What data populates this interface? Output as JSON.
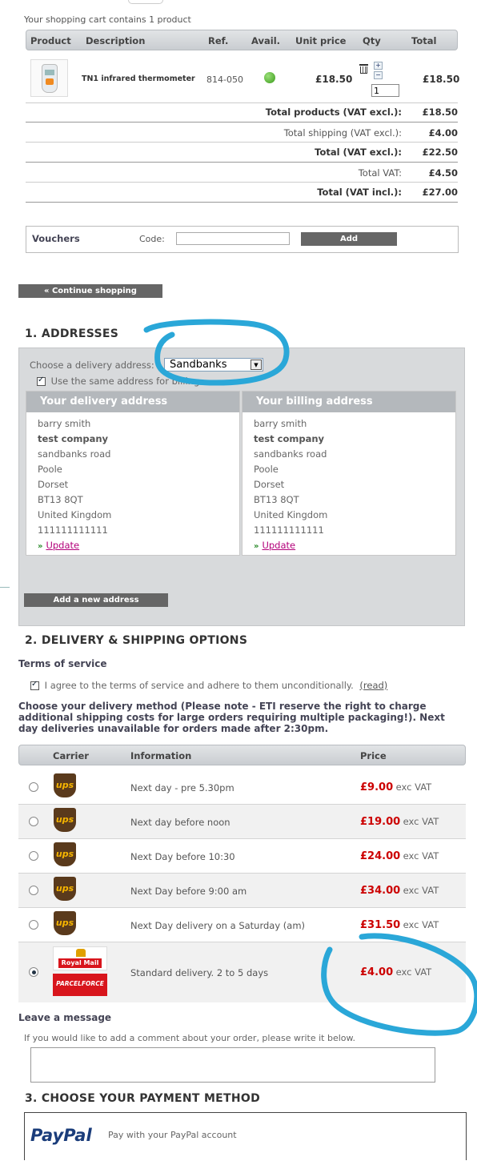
{
  "cart": {
    "summary": "Your shopping cart contains 1 product",
    "headers": [
      "Product",
      "Description",
      "Ref.",
      "Avail.",
      "Unit price",
      "Qty",
      "Total"
    ],
    "item": {
      "description": "TN1 infrared thermometer",
      "ref": "814-050",
      "unit_price": "£18.50",
      "qty": "1",
      "total": "£18.50"
    },
    "totals": [
      {
        "label": "Total products (VAT excl.):",
        "value": "£18.50",
        "bold": true
      },
      {
        "label": "Total shipping (VAT excl.):",
        "value": "£4.00",
        "bold": false
      },
      {
        "label": "Total (VAT excl.):",
        "value": "£22.50",
        "bold": true
      },
      {
        "label": "Total VAT:",
        "value": "£4.50",
        "bold": false
      },
      {
        "label": "Total (VAT incl.):",
        "value": "£27.00",
        "bold": true
      }
    ],
    "vouchers": {
      "title": "Vouchers",
      "code_label": "Code:",
      "add_label": "Add"
    },
    "continue_label": "« Continue shopping"
  },
  "addresses": {
    "title": "1. ADDRESSES",
    "choose_label": "Choose a delivery address:",
    "selected": "Sandbanks",
    "same_billing": "Use the same address for billing.",
    "delivery_title": "Your delivery address",
    "billing_title": "Your billing address",
    "lines": [
      "barry smith",
      "test company",
      "sandbanks road",
      "Poole",
      "Dorset",
      "BT13 8QT",
      "United Kingdom",
      "111111111111"
    ],
    "update_label": "Update",
    "add_new_label": "Add a new address"
  },
  "shipping": {
    "title": "2. DELIVERY & SHIPPING OPTIONS",
    "terms_title": "Terms of service",
    "terms_text": "I agree to the terms of service and adhere to them unconditionally.",
    "terms_read": "(read)",
    "method_note": "Choose your delivery method (Please note - ETI reserve the right to charge additional shipping costs for large orders requiring multiple packaging!). Next day deliveries unavailable for orders made after 2:30pm.",
    "headers": [
      "Carrier",
      "Information",
      "Price"
    ],
    "vat_suffix": "exc VAT",
    "options": [
      {
        "carrier": "UPS",
        "info": "Next day - pre 5.30pm",
        "price": "£9.00",
        "selected": false
      },
      {
        "carrier": "UPS",
        "info": "Next day before noon",
        "price": "£19.00",
        "selected": false
      },
      {
        "carrier": "UPS",
        "info": "Next Day before 10:30",
        "price": "£24.00",
        "selected": false
      },
      {
        "carrier": "UPS",
        "info": "Next Day before 9:00 am",
        "price": "£34.00",
        "selected": false
      },
      {
        "carrier": "UPS",
        "info": "Next Day delivery on a Saturday (am)",
        "price": "£31.50",
        "selected": false
      },
      {
        "carrier": "Royal Mail / Parcelforce",
        "info": "Standard delivery. 2 to 5 days",
        "price": "£4.00",
        "selected": true
      }
    ],
    "royal_mail_label": "Royal Mail",
    "parcelforce_label": "PARCELFORCE"
  },
  "message": {
    "title": "Leave a message",
    "hint": "If you would like to add a comment about your order, please write it below."
  },
  "payment": {
    "title": "3. CHOOSE YOUR PAYMENT METHOD",
    "paypal_logo": "PayPal",
    "paypal_text": "Pay with your PayPal account"
  },
  "colors": {
    "price_red": "#cc0000",
    "annotation_blue": "#2aa7d8",
    "button_gray": "#666666"
  }
}
